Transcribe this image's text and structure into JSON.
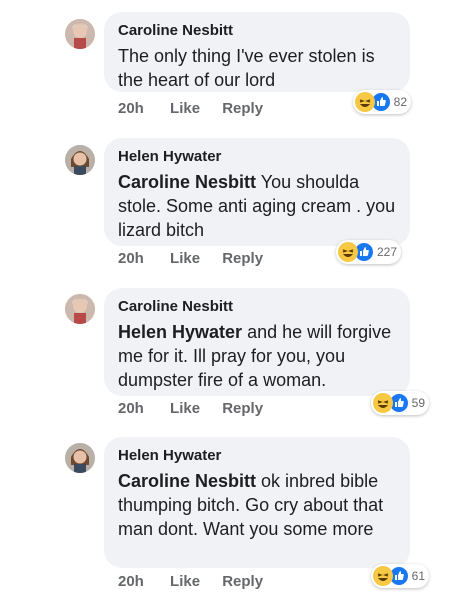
{
  "comments": [
    {
      "author": "Caroline Nesbitt",
      "mention": "",
      "text": "The only thing I've ever stolen is the heart of our lord",
      "time": "20h",
      "like": "Like",
      "reply": "Reply",
      "reaction_count": "82"
    },
    {
      "author": "Helen Hywater",
      "mention": "Caroline Nesbitt",
      "text": "You shoulda stole. Some anti aging  cream . you lizard  bitch",
      "time": "20h",
      "like": "Like",
      "reply": "Reply",
      "reaction_count": "227"
    },
    {
      "author": "Caroline Nesbitt",
      "mention": "Helen Hywater",
      "text": "and he will forgive me for it. Ill pray for you, you dumpster fire of a woman.",
      "time": "20h",
      "like": "Like",
      "reply": "Reply",
      "reaction_count": "59"
    },
    {
      "author": "Helen Hywater",
      "mention": "Caroline Nesbitt",
      "text": "ok  inbred  bible thumping bitch. Go  cry about that man dont. Want you some more",
      "time": "20h",
      "like": "Like",
      "reply": "Reply",
      "reaction_count": "61"
    }
  ],
  "colors": {
    "bubble": "#f0f2f5",
    "like_blue": "#1877f2",
    "haha_yellow": "#f7c843",
    "meta_gray": "#65676b"
  },
  "icons": {
    "avatar": "profile-photo",
    "haha": "haha-reaction-icon",
    "like": "like-reaction-icon"
  }
}
